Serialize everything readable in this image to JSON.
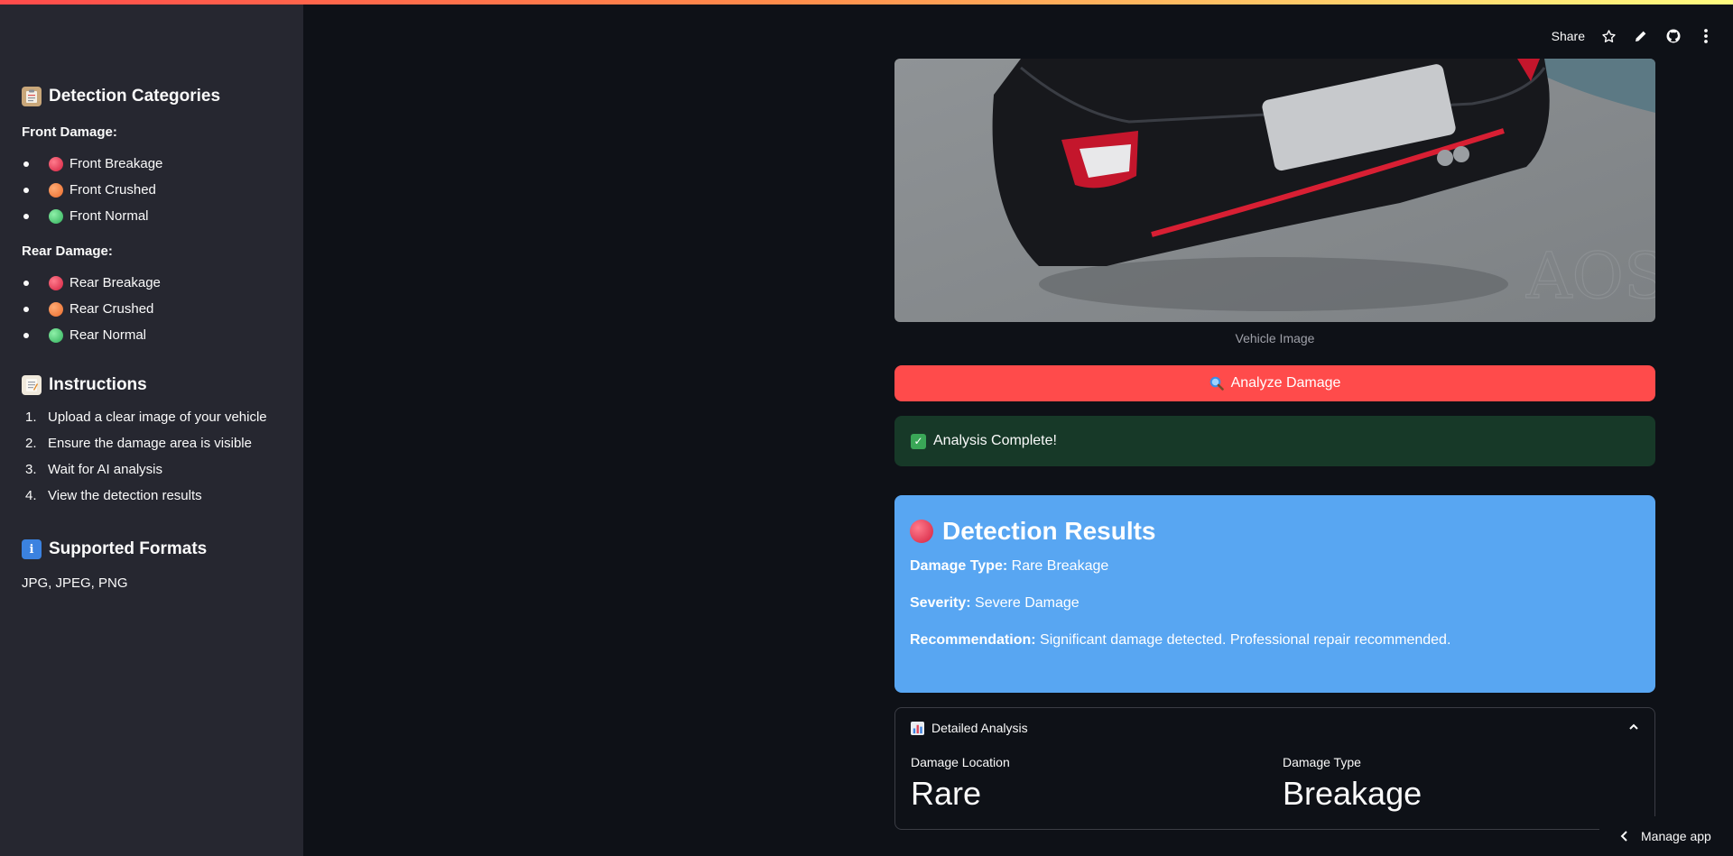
{
  "sidebar": {
    "categories_title": "Detection Categories",
    "front_heading": "Front Damage:",
    "front_items": [
      {
        "label": "Front Breakage",
        "color": "#e23c55"
      },
      {
        "label": "Front Crushed",
        "color": "#f07b3a"
      },
      {
        "label": "Front Normal",
        "color": "#3fc06a"
      }
    ],
    "rear_heading": "Rear Damage:",
    "rear_items": [
      {
        "label": "Rear Breakage",
        "color": "#e23c55"
      },
      {
        "label": "Rear Crushed",
        "color": "#f07b3a"
      },
      {
        "label": "Rear Normal",
        "color": "#3fc06a"
      }
    ],
    "instructions_title": "Instructions",
    "instructions": [
      {
        "num": "1.",
        "text": "Upload a clear image of your vehicle"
      },
      {
        "num": "2.",
        "text": "Ensure the damage area is visible"
      },
      {
        "num": "3.",
        "text": "Wait for AI analysis"
      },
      {
        "num": "4.",
        "text": "View the detection results"
      }
    ],
    "formats_title": "Supported Formats",
    "formats_text": "JPG, JPEG, PNG"
  },
  "toolbar": {
    "share_label": "Share"
  },
  "main": {
    "image_caption": "Vehicle Image",
    "image_watermark": "AOS",
    "analyze_button": "Analyze Damage",
    "success_message": "Analysis Complete!",
    "results": {
      "title": "Detection Results",
      "damage_type_label": "Damage Type:",
      "damage_type_value": "Rare Breakage",
      "severity_label": "Severity:",
      "severity_value": "Severe Damage",
      "recommendation_label": "Recommendation:",
      "recommendation_value": "Significant damage detected. Professional repair recommended."
    },
    "detailed": {
      "title": "Detailed Analysis",
      "location_label": "Damage Location",
      "location_value": "Rare",
      "type_label": "Damage Type",
      "type_value": "Breakage"
    }
  },
  "footer": {
    "manage_app": "Manage app"
  },
  "colors": {
    "accent": "#ff4b4b",
    "results_bg": "#58a6f2",
    "success_bg": "#173928",
    "sidebar_bg": "#262730",
    "app_bg": "#0e1117"
  }
}
